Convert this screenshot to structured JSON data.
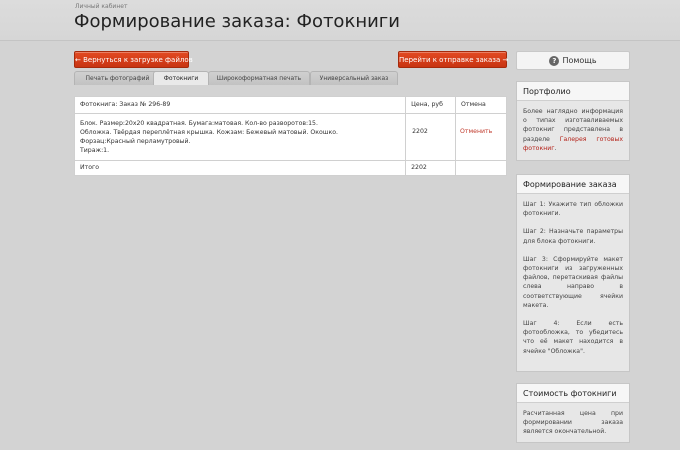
{
  "header": {
    "breadcrumb": "Личный кабинет",
    "title": "Формирование заказа: Фотокниги"
  },
  "toolbar": {
    "back_label": "← Вернуться к загрузке файлов",
    "next_label": "Перейти к отправке заказа →",
    "help_label": "Помощь",
    "help_icon": "?"
  },
  "tabs": [
    {
      "label": "Печать фотографий",
      "active": false
    },
    {
      "label": "Фотокниги",
      "active": true
    },
    {
      "label": "Широкоформатная печать",
      "active": false
    },
    {
      "label": "Универсальный заказ",
      "active": false
    }
  ],
  "order": {
    "headers": {
      "item": "Фотокнига: Заказ № 296-89",
      "price": "Цена, руб",
      "cancel": "Отмена"
    },
    "description": [
      "Блок. Размер:20х20 квадратная. Бумага:матовая. Кол-во разворотов:15.",
      "Обложка. Твёрдая переплётная крышка. Кожзам: Бежевый матовый. Окошко.",
      "Форзац:Красный перламутровый.",
      "Тираж:1."
    ],
    "price": "2202",
    "cancel_label": "Отменить",
    "total_label": "Итого",
    "total_value": "2202"
  },
  "sidebar": {
    "portfolio": {
      "title": "Портфолио",
      "text": "Более наглядно информация о типах изготавливаемых фотокниг представлена в разделе",
      "link": "Галерея готовых фотокниг",
      "tail": "."
    },
    "steps": {
      "title": "Формирование заказа",
      "items": [
        "Шаг 1: Укажите тип обложки фотокниги.",
        "Шаг 2: Назначьте параметры для блока фотокниги.",
        "Шаг 3: Сформируйте макет фотокниги из загруженных файлов, перетаскивая файлы слева направо в соответствующие ячейки макета.",
        "Шаг 4: Если есть фотообложка, то убедитесь что её макет находится в ячейке \"Обложка\"."
      ]
    },
    "cost": {
      "title": "Стоимость фотокниги",
      "text": "Расчитанная цена при формировании заказа является окончательной."
    }
  },
  "colors": {
    "accent": "#c83412",
    "link": "#b5231a",
    "background": "#d3d3d3"
  }
}
